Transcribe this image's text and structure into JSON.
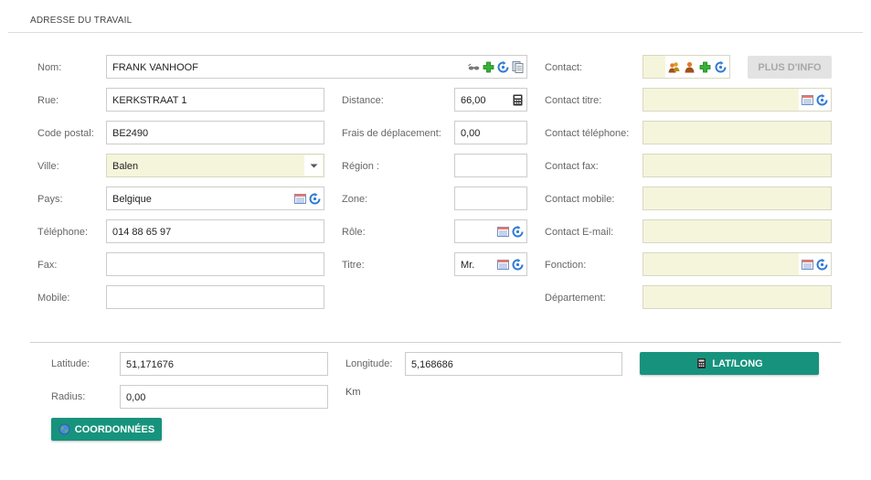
{
  "section": {
    "title": "ADRESSE DU TRAVAIL"
  },
  "left": {
    "nom": {
      "label": "Nom:",
      "value": "FRANK VANHOOF"
    },
    "rue": {
      "label": "Rue:",
      "value": "KERKSTRAAT 1"
    },
    "code_postal": {
      "label": "Code postal:",
      "value": "BE2490"
    },
    "ville": {
      "label": "Ville:",
      "value": "Balen"
    },
    "pays": {
      "label": "Pays:",
      "value": "Belgique"
    },
    "telephone": {
      "label": "Téléphone:",
      "value": "014 88 65 97"
    },
    "fax": {
      "label": "Fax:",
      "value": ""
    },
    "mobile": {
      "label": "Mobile:",
      "value": ""
    }
  },
  "middle": {
    "distance": {
      "label": "Distance:",
      "value": "66,00"
    },
    "frais": {
      "label": "Frais de déplacement:",
      "value": "0,00"
    },
    "region": {
      "label": "Région :",
      "value": ""
    },
    "zone": {
      "label": "Zone:",
      "value": ""
    },
    "role": {
      "label": "Rôle:",
      "value": ""
    },
    "titre": {
      "label": "Titre:",
      "value": "Mr."
    }
  },
  "right": {
    "contact": {
      "label": "Contact:",
      "value": ""
    },
    "plus_info": "PLUS D'INFO",
    "contact_titre": {
      "label": "Contact titre:",
      "value": ""
    },
    "contact_telephone": {
      "label": "Contact téléphone:",
      "value": ""
    },
    "contact_fax": {
      "label": "Contact fax:",
      "value": ""
    },
    "contact_mobile": {
      "label": "Contact mobile:",
      "value": ""
    },
    "contact_email": {
      "label": "Contact E-mail:",
      "value": ""
    },
    "fonction": {
      "label": "Fonction:",
      "value": ""
    },
    "departement": {
      "label": "Département:",
      "value": ""
    }
  },
  "geo": {
    "latitude": {
      "label": "Latitude:",
      "value": "51,171676"
    },
    "longitude": {
      "label": "Longitude:",
      "value": "5,168686"
    },
    "latlong_button": "LAT/LONG",
    "radius": {
      "label": "Radius:",
      "value": "0,00"
    },
    "unit": "Km",
    "coordonnees_button": "COORDONNÉES"
  },
  "colors": {
    "accent": "#17937d",
    "yellow_field": "#f5f5dc",
    "button_gray": "#e3e3e3"
  },
  "icons": [
    "glasses-icon",
    "add-icon",
    "refresh-icon",
    "copy-icon",
    "calculator-icon",
    "calendar-list-icon",
    "person-icon",
    "chevron-down-icon",
    "globe-icon"
  ]
}
